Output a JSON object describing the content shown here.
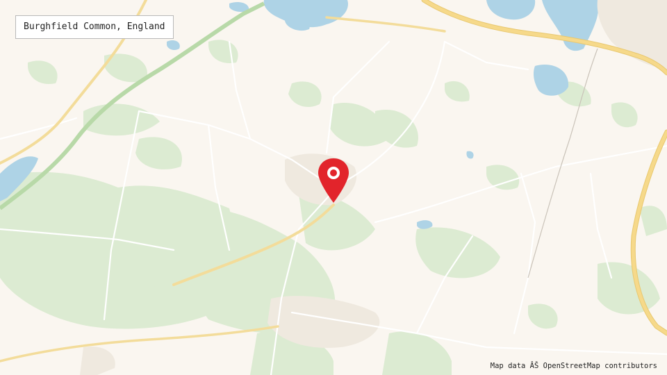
{
  "place_label": "Burghfield Common, England",
  "attribution": "Map data ÂŠ OpenStreetMap contributors",
  "colors": {
    "background": "#faf6f0",
    "woodland": "#dcebd2",
    "water": "#aed3e6",
    "major_road": "#f6d98a",
    "minor_road": "#fdfbf7",
    "pin": "#e2242b"
  },
  "icons": {
    "marker": "map-marker-icon"
  }
}
